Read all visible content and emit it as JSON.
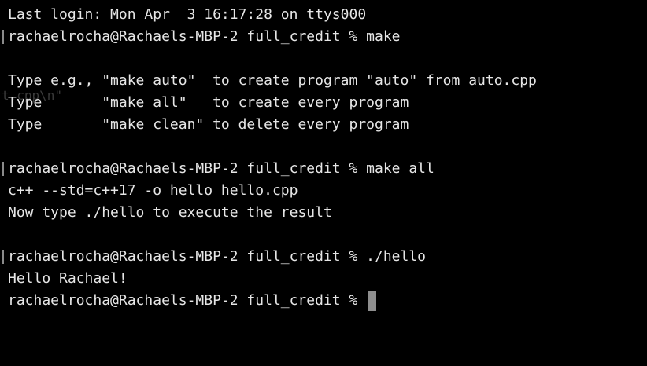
{
  "terminal": {
    "last_login": "Last login: Mon Apr  3 16:17:28 on ttys000",
    "ghost_text": "t.cpp\\n\"",
    "lines": [
      "rachaelrocha@Rachaels-MBP-2 full_credit % make",
      "",
      "Type e.g., \"make auto\"  to create program \"auto\" from auto.cpp",
      "Type       \"make all\"   to create every program",
      "Type       \"make clean\" to delete every program",
      "",
      "rachaelrocha@Rachaels-MBP-2 full_credit % make all",
      "c++ --std=c++17 -o hello hello.cpp",
      "Now type ./hello to execute the result",
      "",
      "rachaelrocha@Rachaels-MBP-2 full_credit % ./hello",
      "Hello Rachael!"
    ],
    "current_prompt": "rachaelrocha@Rachaels-MBP-2 full_credit % "
  }
}
